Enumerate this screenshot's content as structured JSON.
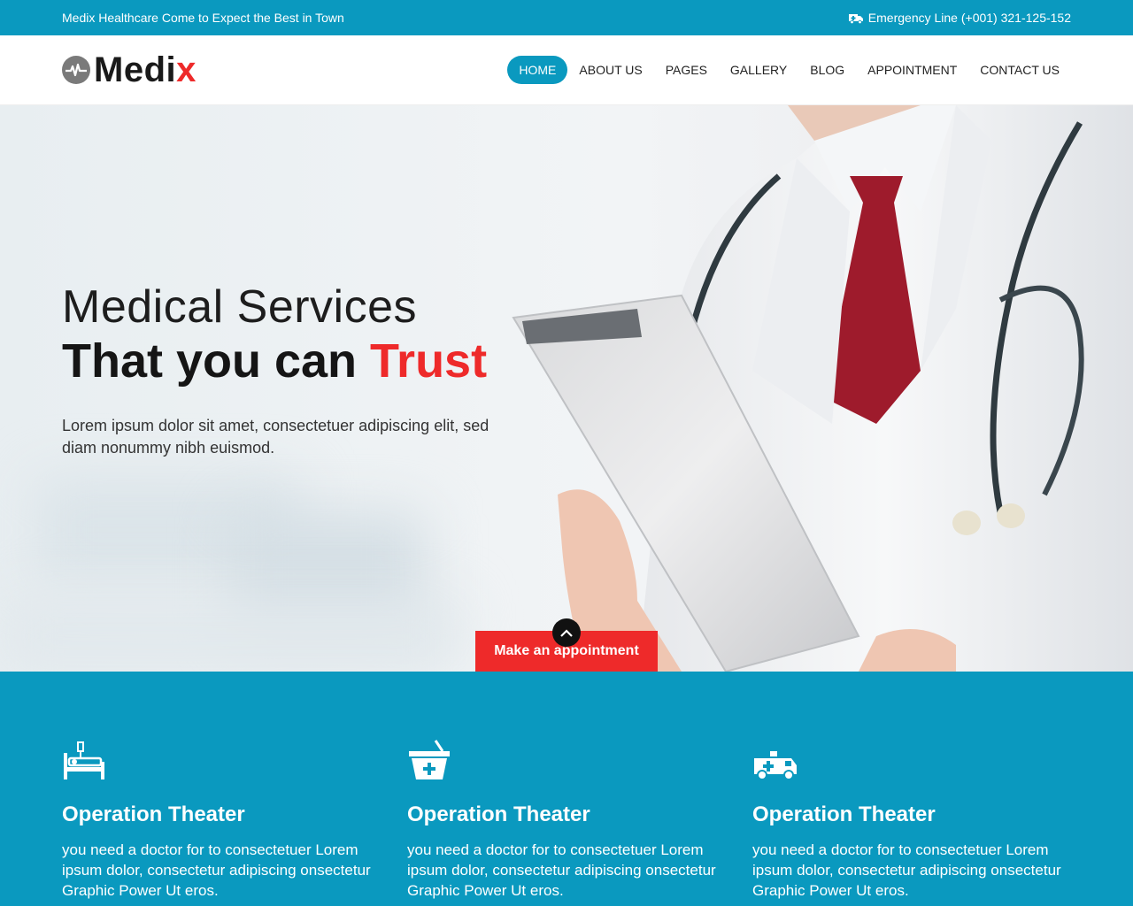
{
  "topbar": {
    "tagline": "Medix Healthcare Come to Expect the Best in Town",
    "emergency": "Emergency Line (+001) 321-125-152",
    "emergency_icon": "ambulance-icon"
  },
  "logo": {
    "icon": "heartbeat-icon",
    "text_main": "Medi",
    "text_accent": "x"
  },
  "nav": {
    "items": [
      {
        "label": "HOME",
        "active": true
      },
      {
        "label": "ABOUT US",
        "active": false
      },
      {
        "label": "PAGES",
        "active": false
      },
      {
        "label": "GALLERY",
        "active": false
      },
      {
        "label": "BLOG",
        "active": false
      },
      {
        "label": "APPOINTMENT",
        "active": false
      },
      {
        "label": "CONTACT US",
        "active": false
      }
    ]
  },
  "hero": {
    "line1": "Medical Services",
    "line2_main": "That you can ",
    "line2_accent": "Trust",
    "description": "Lorem ipsum dolor sit amet, consectetuer adipiscing elit, sed diam nonummy nibh euismod.",
    "button": "Make an appointment",
    "scroll_icon": "chevron-up-icon"
  },
  "services": [
    {
      "icon": "hospital-bed-icon",
      "title": "Operation Theater",
      "description": "you need a doctor for to consectetuer Lorem ipsum dolor, consectetur adipiscing onsectetur Graphic Power Ut eros."
    },
    {
      "icon": "medicine-basket-icon",
      "title": "Operation Theater",
      "description": "you need a doctor for to consectetuer Lorem ipsum dolor, consectetur adipiscing onsectetur Graphic Power Ut eros."
    },
    {
      "icon": "ambulance-icon",
      "title": "Operation Theater",
      "description": "you need a doctor for to consectetuer Lorem ipsum dolor, consectetur adipiscing onsectetur Graphic Power Ut eros."
    }
  ],
  "colors": {
    "primary": "#0a99bf",
    "accent": "#ee2a2a"
  }
}
